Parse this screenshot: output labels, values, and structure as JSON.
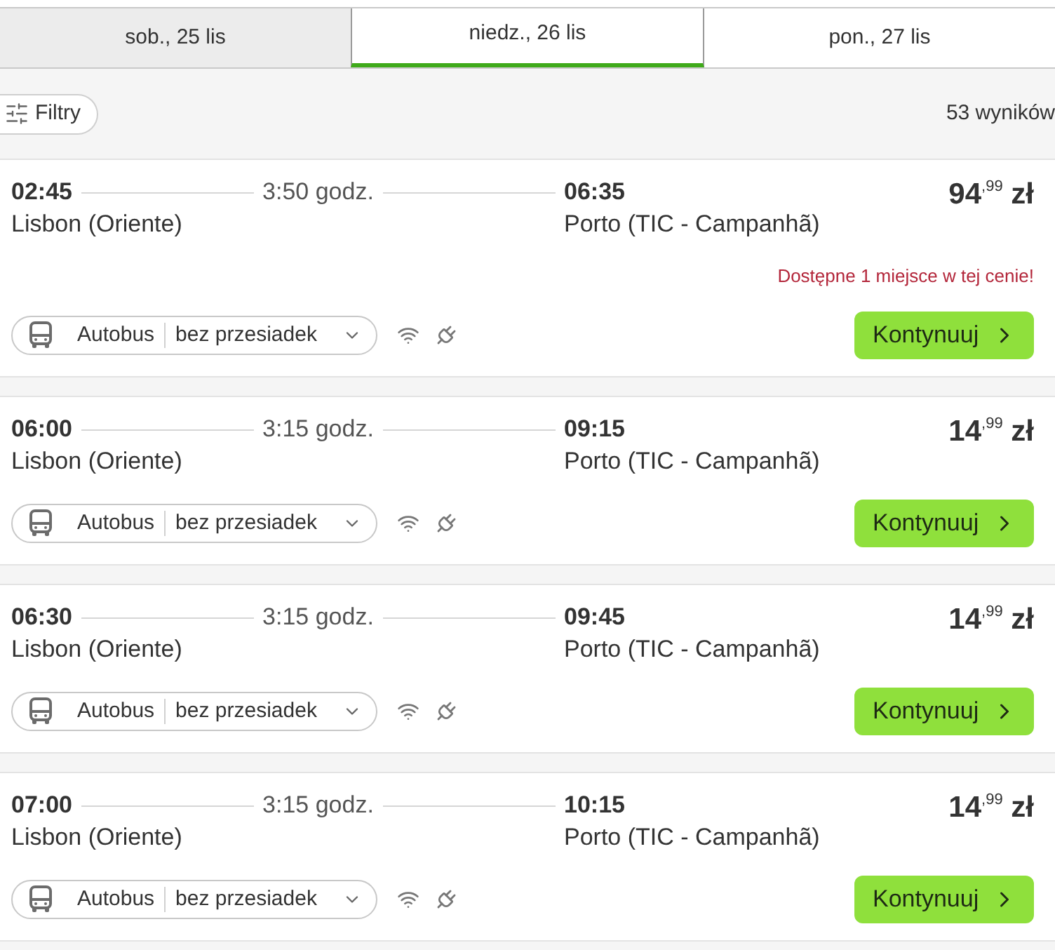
{
  "date_tabs": [
    {
      "label": "sob., 25 lis",
      "selected": false,
      "past": true
    },
    {
      "label": "niedz., 26 lis",
      "selected": true,
      "past": false
    },
    {
      "label": "pon., 27 lis",
      "selected": false,
      "past": false
    }
  ],
  "toolbar": {
    "filter_button": "Filtry",
    "results_count": "53 wyników"
  },
  "results": [
    {
      "departure_time": "02:45",
      "duration": "3:50 godz.",
      "arrival_time": "06:35",
      "departure_station": "Lisbon (Oriente)",
      "arrival_station": "Porto (TIC - Campanhã)",
      "price": "94$^{,99}$ zł",
      "alert": "Dostępne 1 miejsce w tej cenie!",
      "transport": "Autobus",
      "transfers": "bez przesiadek",
      "button": "Kontynuuj"
    },
    {
      "departure_time": "06:00",
      "duration": "3:15 godz.",
      "arrival_time": "09:15",
      "departure_station": "Lisbon (Oriente)",
      "arrival_station": "Porto (TIC - Campanhã)",
      "price": "14$^{,99}$ zł",
      "transport": "Autobus",
      "transfers": "bez przesiadek",
      "button": "Kontynuuj"
    },
    {
      "departure_time": "06:30",
      "duration": "3:15 godz.",
      "arrival_time": "09:45",
      "departure_station": "Lisbon (Oriente)",
      "arrival_station": "Porto (TIC - Campanhã)",
      "price": "14$^{,99}$ zł",
      "transport": "Autobus",
      "transfers": "bez przesiadek",
      "button": "Kontynuuj"
    },
    {
      "departure_time": "07:00",
      "duration": "3:15 godz.",
      "arrival_time": "10:15",
      "departure_station": "Lisbon (Oriente)",
      "arrival_station": "Porto (TIC - Campanhã)",
      "price": "14$^{,99}$ zł",
      "transport": "Autobus",
      "transfers": "bez przesiadek",
      "button": "Kontynuuj"
    }
  ]
}
